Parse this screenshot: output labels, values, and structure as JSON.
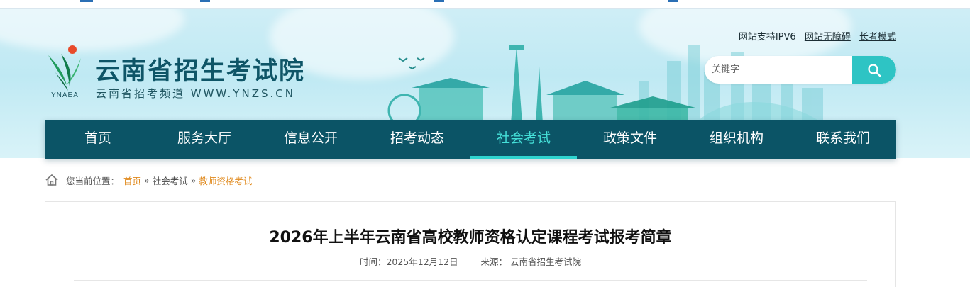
{
  "header": {
    "site_name": "云南省招生考试院",
    "site_sub": "云南省招考频道 WWW.YNZS.CN",
    "logo_abbr": "YNAEA",
    "links": [
      "网站支持IPV6",
      "网站无障碍",
      "长者模式"
    ]
  },
  "search": {
    "placeholder": "关键字",
    "button_icon": "search-icon"
  },
  "nav": {
    "items": [
      "首页",
      "服务大厅",
      "信息公开",
      "招考动态",
      "社会考试",
      "政策文件",
      "组织机构",
      "联系我们"
    ],
    "active": "社会考试"
  },
  "breadcrumb": {
    "prefix": "您当前位置：",
    "home": "首页",
    "level2": "社会考试",
    "current": "教师资格考试",
    "separator": "»"
  },
  "article": {
    "title": "2026年上半年云南省高校教师资格认定课程考试报考简章",
    "time_label": "时间：",
    "time": "2025年12月12日",
    "source_label": "来源：",
    "source": "云南省招生考试院"
  },
  "colors": {
    "nav_bg": "#0b5466",
    "nav_active": "#45e0d8",
    "accent": "#2ec4c4",
    "breadcrumb_link": "#e08a1e",
    "brand_text": "#0e5567"
  }
}
